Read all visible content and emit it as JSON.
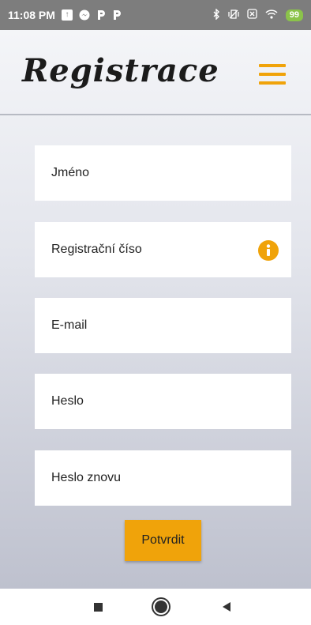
{
  "statusbar": {
    "time": "11:08 PM",
    "left_icons": [
      "notification-box-icon",
      "messenger-icon",
      "p-icon",
      "p-icon"
    ],
    "right_icons": [
      "bluetooth-icon",
      "vibrate-icon",
      "sim-icon",
      "wifi-icon"
    ],
    "battery_level": "99"
  },
  "header": {
    "title": "Registrace",
    "menu_icon": "hamburger-menu-icon",
    "accent_color": "#f0a30a"
  },
  "form": {
    "fields": [
      {
        "label": "Jméno"
      },
      {
        "label": "Registrační číso",
        "icon": "info-icon"
      },
      {
        "label": "E-mail"
      },
      {
        "label": "Heslo"
      },
      {
        "label": "Heslo znovu"
      }
    ],
    "submit_label": "Potvrdit"
  },
  "navbar": {
    "icons": [
      "recent-apps-icon",
      "home-icon",
      "back-icon"
    ]
  }
}
